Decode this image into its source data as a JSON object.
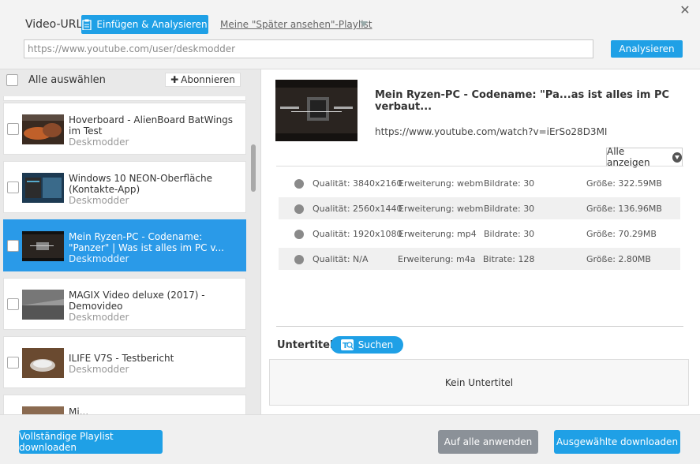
{
  "header": {
    "url_label": "Video-URL",
    "paste_button": "Einfügen & Analysieren",
    "playlist_link": "Meine \"Später ansehen\"-Playlist",
    "url_value": "https://www.youtube.com/user/deskmodder",
    "analyze_button": "Analysieren"
  },
  "left": {
    "select_all": "Alle auswählen",
    "subscribe": "Abonnieren",
    "items": [
      {
        "title": "Hoverboard - AlienBoard BatWings im Test",
        "channel": "Deskmodder"
      },
      {
        "title": "Windows 10 NEON-Oberfläche (Kontakte-App)",
        "channel": "Deskmodder"
      },
      {
        "title": "Mein Ryzen-PC - Codename: \"Panzer\" | Was ist alles im PC v...",
        "channel": "Deskmodder"
      },
      {
        "title": "MAGIX Video deluxe (2017) - Demovideo",
        "channel": "Deskmodder"
      },
      {
        "title": "ILIFE V7S - Testbericht",
        "channel": "Deskmodder"
      },
      {
        "title": "Mi...",
        "channel": ""
      }
    ]
  },
  "detail": {
    "title": "Mein Ryzen-PC - Codename: \"Pa...as ist alles im PC verbaut...",
    "url": "https://www.youtube.com/watch?v=iErSo28D3MI",
    "show_all": "Alle anzeigen",
    "formats": [
      {
        "quality": "Qualität: 3840x2160",
        "ext": "Erweiterung: webm",
        "bitrate": "Bildrate: 30",
        "size": "Größe: 322.59MB"
      },
      {
        "quality": "Qualität: 2560x1440",
        "ext": "Erweiterung: webm",
        "bitrate": "Bildrate: 30",
        "size": "Größe: 136.96MB"
      },
      {
        "quality": "Qualität: 1920x1080",
        "ext": "Erweiterung: mp4",
        "bitrate": "Bildrate: 30",
        "size": "Größe: 70.29MB"
      },
      {
        "quality": "Qualität: N/A",
        "ext": "Erweiterung: m4a",
        "bitrate": "Bitrate: 128",
        "size": "Größe: 2.80MB"
      }
    ],
    "subtitle_label": "Untertitel",
    "search_button": "Suchen",
    "no_subtitle": "Kein Untertitel"
  },
  "footer": {
    "download_playlist": "Vollständige Playlist downloaden",
    "apply_all": "Auf alle anwenden",
    "download_selected": "Ausgewählte downloaden"
  },
  "colors": {
    "accent": "#1fa0e6",
    "selected": "#2a9ae8"
  }
}
